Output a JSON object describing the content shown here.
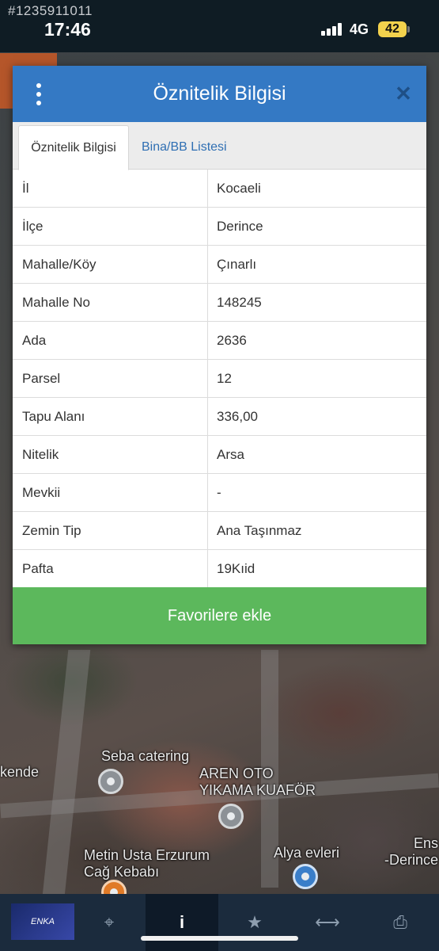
{
  "status_bar": {
    "call_id": "#1235911011",
    "time": "17:46",
    "network": "4G",
    "battery": "42"
  },
  "dialog": {
    "title": "Öznitelik Bilgisi",
    "tabs": [
      {
        "label": "Öznitelik Bilgisi",
        "active": true
      },
      {
        "label": "Bina/BB Listesi",
        "active": false
      }
    ],
    "rows": [
      {
        "key": "İl",
        "value": "Kocaeli"
      },
      {
        "key": "İlçe",
        "value": "Derince"
      },
      {
        "key": "Mahalle/Köy",
        "value": "Çınarlı"
      },
      {
        "key": "Mahalle No",
        "value": "148245"
      },
      {
        "key": "Ada",
        "value": "2636"
      },
      {
        "key": "Parsel",
        "value": "12"
      },
      {
        "key": "Tapu Alanı",
        "value": "336,00"
      },
      {
        "key": "Nitelik",
        "value": "Arsa"
      },
      {
        "key": "Mevkii",
        "value": "-"
      },
      {
        "key": "Zemin Tip",
        "value": "Ana Taşınmaz"
      },
      {
        "key": "Pafta",
        "value": "19Kıid"
      }
    ],
    "favorite_button": "Favorilere ekle"
  },
  "map": {
    "labels": [
      "Seba catering",
      "AREN OTO\nYIKAMA KUAFÖR",
      "Metin Usta Erzurum\nCağ Kebabı",
      "Alya evleri",
      "kende",
      "Ens\n-Derince"
    ]
  },
  "bottom_bar": {
    "logo_text": "ENKA",
    "items": [
      {
        "icon": "crosshair-icon",
        "glyph": "⌖"
      },
      {
        "icon": "info-icon",
        "glyph": "i"
      },
      {
        "icon": "star-icon",
        "glyph": "★"
      },
      {
        "icon": "measure-icon",
        "glyph": "⟷"
      },
      {
        "icon": "print-icon",
        "glyph": "⎙"
      }
    ]
  }
}
